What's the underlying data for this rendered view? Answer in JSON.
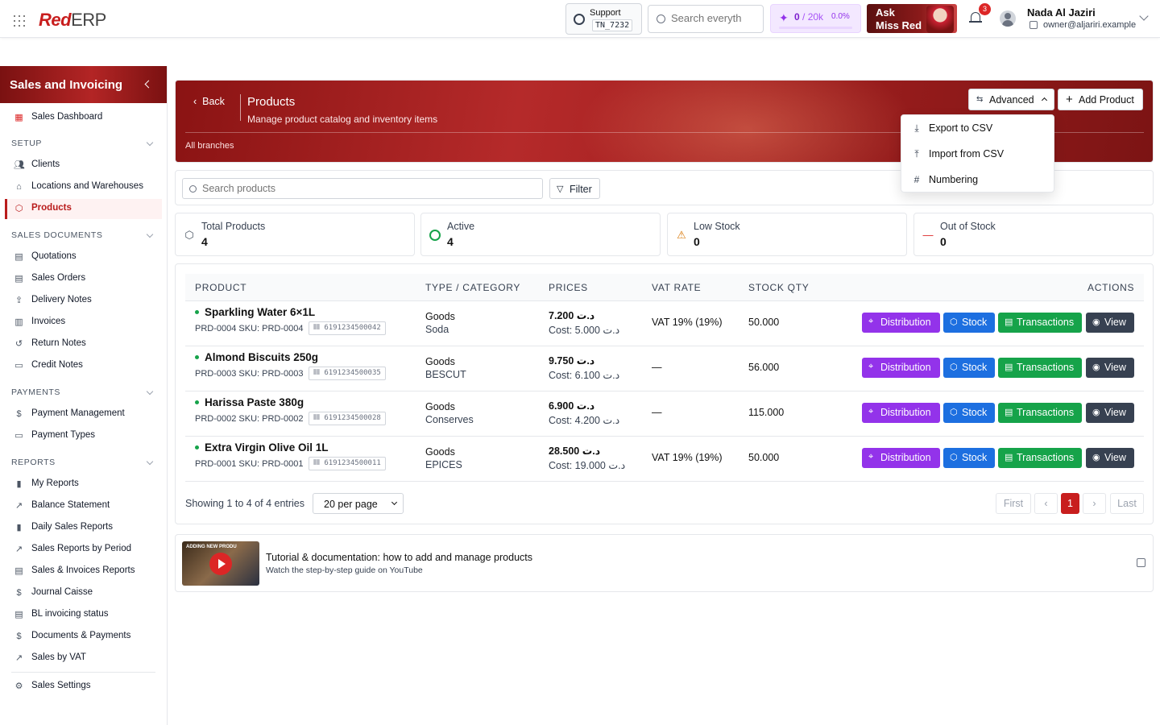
{
  "app": {
    "logo_red": "Red",
    "logo_erp": "ERP"
  },
  "topbar": {
    "support_label": "Support",
    "support_id": "TN_7232",
    "search_placeholder": "Search everyth",
    "credits_used": "0",
    "credits_total": "/ 20k",
    "credits_pct": "0.0%",
    "credits_progress": 0,
    "ask_line1": "Ask",
    "ask_line2": "Miss Red",
    "notif_count": "3",
    "user_name": "Nada Al Jaziri",
    "user_email": "owner@aljariri.example"
  },
  "sidebar": {
    "title": "Sales and Invoicing",
    "dashboard": "Sales Dashboard",
    "sections": {
      "setup": "SETUP",
      "sales_docs": "SALES DOCUMENTS",
      "payments": "PAYMENTS",
      "reports": "REPORTS"
    },
    "setup_items": [
      "Clients",
      "Locations and Warehouses",
      "Products"
    ],
    "doc_items": [
      "Quotations",
      "Sales Orders",
      "Delivery Notes",
      "Invoices",
      "Return Notes",
      "Credit Notes"
    ],
    "payment_items": [
      "Payment Management",
      "Payment Types"
    ],
    "report_items": [
      "My Reports",
      "Balance Statement",
      "Daily Sales Reports",
      "Sales Reports by Period",
      "Sales & Invoices Reports",
      "Journal Caisse",
      "BL invoicing status",
      "Documents & Payments",
      "Sales by VAT"
    ],
    "settings": "Sales Settings"
  },
  "header": {
    "back": "Back",
    "title": "Products",
    "subtitle": "Manage product catalog and inventory items",
    "branches": "All branches",
    "advanced": "Advanced",
    "add_product": "Add Product"
  },
  "advanced_menu": [
    "Export to CSV",
    "Import from CSV",
    "Numbering"
  ],
  "toolbar": {
    "search_placeholder": "Search products",
    "filter": "Filter"
  },
  "stats": [
    {
      "label": "Total Products",
      "value": "4"
    },
    {
      "label": "Active",
      "value": "4"
    },
    {
      "label": "Low Stock",
      "value": "0"
    },
    {
      "label": "Out of Stock",
      "value": "0"
    }
  ],
  "table": {
    "headers": [
      "PRODUCT",
      "TYPE / CATEGORY",
      "PRICES",
      "VAT RATE",
      "STOCK QTY",
      "ACTIONS"
    ],
    "actions": [
      "Distribution",
      "Stock",
      "Transactions",
      "View"
    ],
    "rows": [
      {
        "name": "Sparkling Water 6×1L",
        "meta": "PRD-0004  SKU: PRD-0004",
        "barcode": "6191234500042",
        "type": "Goods",
        "category": "Soda",
        "price": "7.200 د.ت",
        "cost": "Cost: 5.000 د.ت",
        "vat": "VAT 19% (19%)",
        "qty": "50.000"
      },
      {
        "name": "Almond Biscuits 250g",
        "meta": "PRD-0003  SKU: PRD-0003",
        "barcode": "6191234500035",
        "type": "Goods",
        "category": "BESCUT",
        "price": "9.750 د.ت",
        "cost": "Cost: 6.100 د.ت",
        "vat": "—",
        "qty": "56.000"
      },
      {
        "name": "Harissa Paste 380g",
        "meta": "PRD-0002  SKU: PRD-0002",
        "barcode": "6191234500028",
        "type": "Goods",
        "category": "Conserves",
        "price": "6.900 د.ت",
        "cost": "Cost: 4.200 د.ت",
        "vat": "—",
        "qty": "115.000"
      },
      {
        "name": "Extra Virgin Olive Oil 1L",
        "meta": "PRD-0001  SKU: PRD-0001",
        "barcode": "6191234500011",
        "type": "Goods",
        "category": "EPICES",
        "price": "28.500 د.ت",
        "cost": "Cost: 19.000 د.ت",
        "vat": "VAT 19% (19%)",
        "qty": "50.000"
      }
    ]
  },
  "pagination": {
    "showing": "Showing 1 to 4 of 4 entries",
    "per_page": "20 per page",
    "first": "First",
    "prev": "‹",
    "current": "1",
    "next": "›",
    "last": "Last"
  },
  "tutorial": {
    "thumb_caption": "ADDING NEW PRODU",
    "title": "Tutorial & documentation: how to add and manage products",
    "subtitle": "Watch the step-by-step guide on YouTube"
  }
}
